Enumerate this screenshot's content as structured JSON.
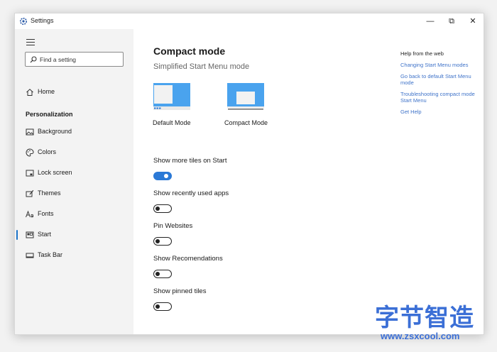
{
  "window": {
    "title": "Settings",
    "controls": {
      "minimize": "—",
      "maximize": "⧉",
      "close": "✕"
    }
  },
  "sidebar": {
    "search_placeholder": "Find a setting",
    "home": "Home",
    "section": "Personalization",
    "items": [
      {
        "label": "Background",
        "icon": "image-icon"
      },
      {
        "label": "Colors",
        "icon": "palette-icon"
      },
      {
        "label": "Lock screen",
        "icon": "lock-screen-icon"
      },
      {
        "label": "Themes",
        "icon": "brush-icon"
      },
      {
        "label": "Fonts",
        "icon": "fonts-icon"
      },
      {
        "label": "Start",
        "icon": "start-icon",
        "selected": true
      },
      {
        "label": "Task Bar",
        "icon": "taskbar-icon"
      }
    ]
  },
  "main": {
    "title": "Compact mode",
    "subtitle": "Simplified Start Menu mode",
    "modes": [
      {
        "caption": "Default Mode",
        "selected": false
      },
      {
        "caption": "Compact Mode",
        "selected": true
      }
    ],
    "options": [
      {
        "label": "Show more tiles on Start",
        "on": true
      },
      {
        "label": "Show recently used apps",
        "on": false
      },
      {
        "label": "Pin Websites",
        "on": false
      },
      {
        "label": "Show Recomendations",
        "on": false
      },
      {
        "label": "Show pinned tiles",
        "on": false
      }
    ]
  },
  "help": {
    "title": "Help from the web",
    "links": [
      "Changing Start Menu modes",
      "Go back to default Start Menu mode",
      "Troubleshooting compact mode Start Menu",
      "Get Help"
    ]
  },
  "watermark": {
    "big": "字节智造",
    "small": "www.zsxcool.com"
  },
  "colors": {
    "accent": "#2b79d6",
    "link": "#3f73c9",
    "sidebar_bg": "#f3f3f3",
    "watermark": "#3b6fd6"
  }
}
